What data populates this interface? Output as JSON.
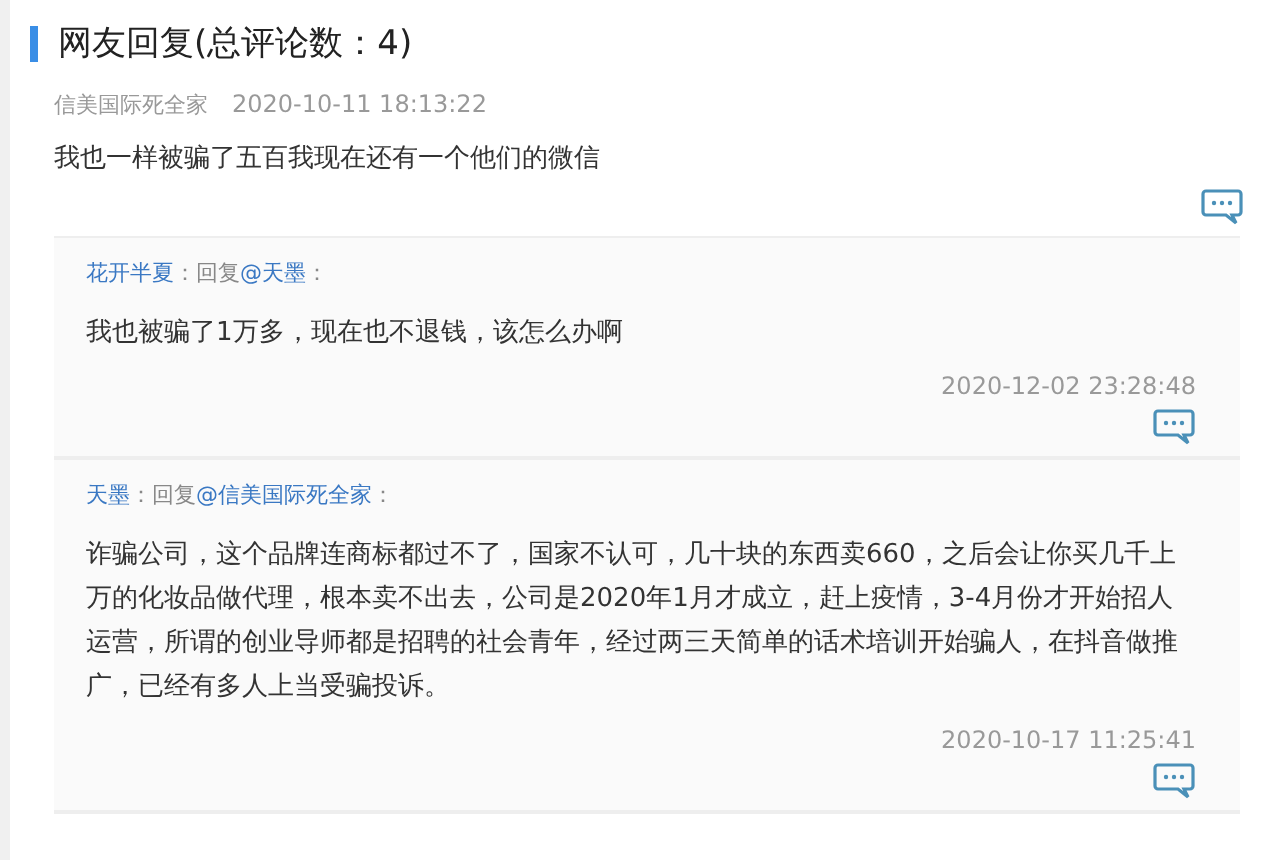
{
  "title": "网友回复(总评论数：4)",
  "comment": {
    "author": "信美国际死全家",
    "time": "2020-10-11 18:13:22",
    "text": "我也一样被骗了五百我现在还有一个他们的微信"
  },
  "replies": [
    {
      "author": "花开半夏",
      "connector": "：回复",
      "target": "@天墨",
      "suffix": "：",
      "text": "我也被骗了1万多，现在也不退钱，该怎么办啊",
      "time": "2020-12-02 23:28:48"
    },
    {
      "author": "天墨",
      "connector": "：回复",
      "target": "@信美国际死全家",
      "suffix": "：",
      "text": "诈骗公司，这个品牌连商标都过不了，国家不认可，几十块的东西卖660，之后会让你买几千上万的化妆品做代理，根本卖不出去，公司是2020年1月才成立，赶上疫情，3-4月份才开始招人运营，所谓的创业导师都是招聘的社会青年，经过两三天简单的话术培训开始骗人，在抖音做推广，已经有多人上当受骗投诉。",
      "time": "2020-10-17 11:25:41"
    }
  ]
}
